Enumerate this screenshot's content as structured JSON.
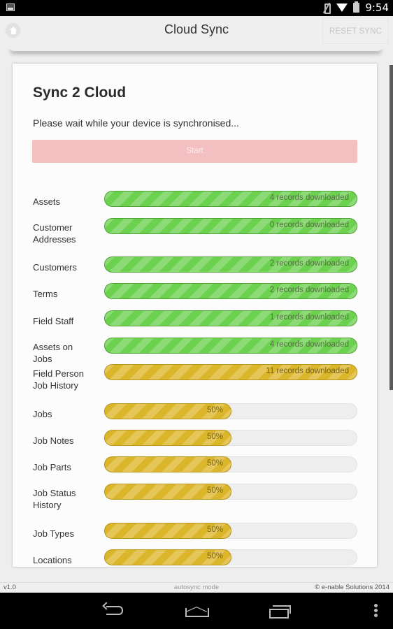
{
  "status_bar": {
    "time": "9:54",
    "icons": [
      "notification-image-icon",
      "mute-icon",
      "wifi-icon",
      "battery-icon"
    ]
  },
  "header": {
    "title": "Cloud Sync",
    "home_icon": "home-icon",
    "reset_label": "RESET SYNC"
  },
  "card": {
    "title": "Sync 2 Cloud",
    "subtitle": "Please wait while your device is synchronised...",
    "start_label": "Start"
  },
  "sync_items": [
    {
      "label": "Assets",
      "status_text": "4 records downloaded",
      "progress_percent": 100,
      "color": "#6dd150"
    },
    {
      "label": "Customer Addresses",
      "status_text": "0 records downloaded",
      "progress_percent": 100,
      "color": "#6dd150"
    },
    {
      "label": "Customers",
      "status_text": "2 records downloaded",
      "progress_percent": 100,
      "color": "#6dd150"
    },
    {
      "label": "Terms",
      "status_text": "2 records downloaded",
      "progress_percent": 100,
      "color": "#6dd150"
    },
    {
      "label": "Field Staff",
      "status_text": "1 records downloaded",
      "progress_percent": 100,
      "color": "#6dd150"
    },
    {
      "label": "Assets on Jobs",
      "status_text": "4 records downloaded",
      "progress_percent": 100,
      "color": "#6dd150"
    },
    {
      "label": "Field Person Job History",
      "status_text": "11 records downloaded",
      "progress_percent": 100,
      "color": "#dcb62a"
    },
    {
      "label": "Jobs",
      "status_text": "50%",
      "progress_percent": 50,
      "color": "#dcb62a"
    },
    {
      "label": "Job Notes",
      "status_text": "50%",
      "progress_percent": 50,
      "color": "#dcb62a"
    },
    {
      "label": "Job Parts",
      "status_text": "50%",
      "progress_percent": 50,
      "color": "#dcb62a"
    },
    {
      "label": "Job Status History",
      "status_text": "50%",
      "progress_percent": 50,
      "color": "#dcb62a"
    },
    {
      "label": "Job Types",
      "status_text": "50%",
      "progress_percent": 50,
      "color": "#dcb62a"
    },
    {
      "label": "Locations",
      "status_text": "50%",
      "progress_percent": 50,
      "color": "#dcb62a"
    }
  ],
  "footer": {
    "version": "v1.0",
    "mode": "autosync mode",
    "copyright": "© e-nable Solutions 2014"
  },
  "nav_bar": {
    "buttons": [
      "back-icon",
      "home-icon",
      "recent-apps-icon",
      "overflow-menu-icon"
    ]
  },
  "colors": {
    "complete": "#6dd150",
    "in_progress": "#dcb62a",
    "start_button": "#f4bfc1"
  }
}
